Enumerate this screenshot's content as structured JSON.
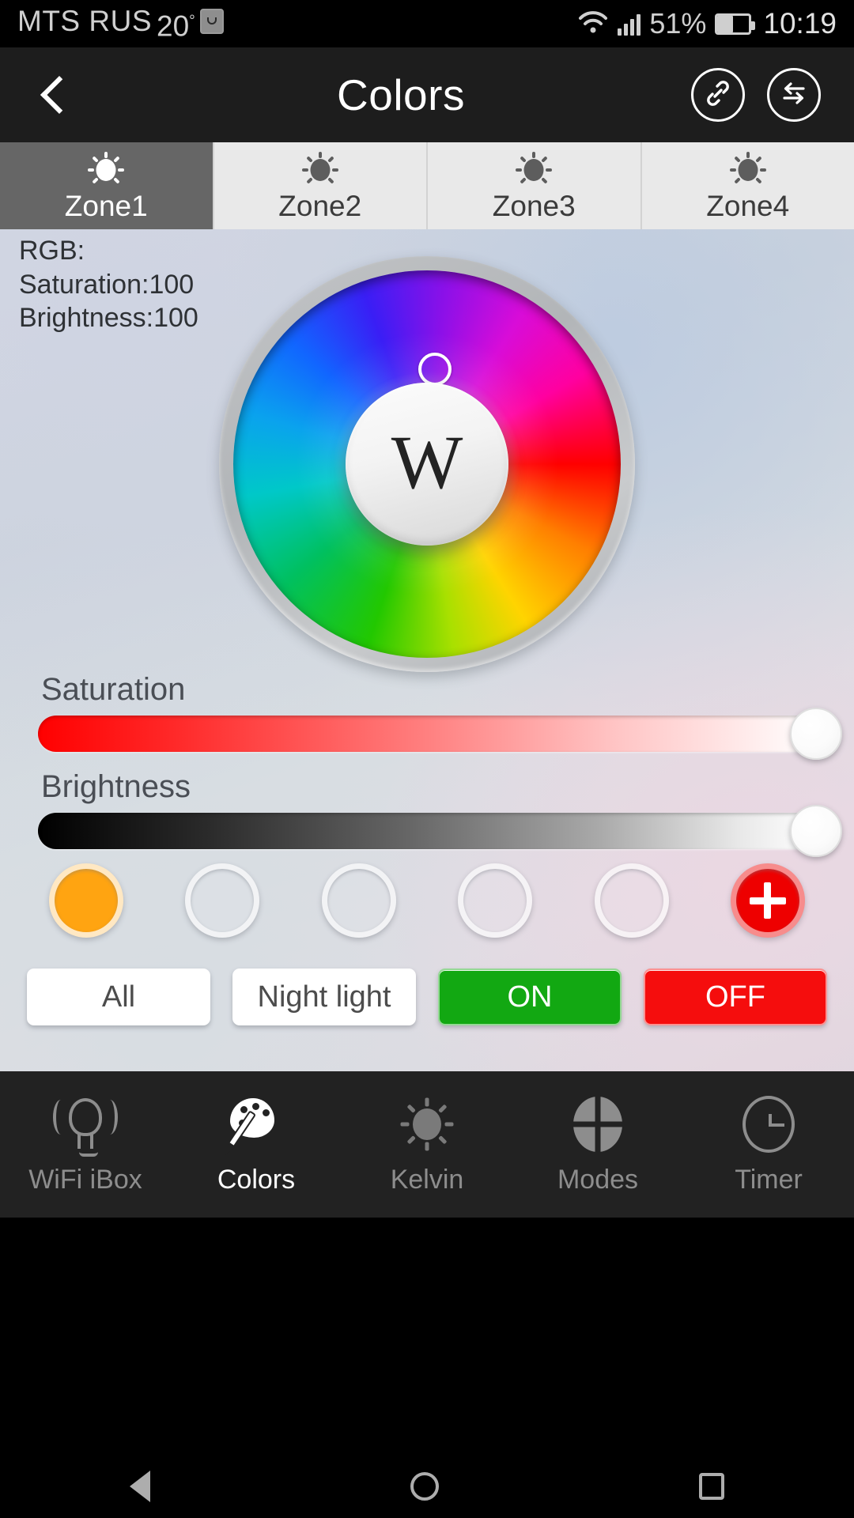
{
  "status_bar": {
    "carrier": "MTS RUS",
    "temperature": "20",
    "degree": "°",
    "battery_percent": "51%",
    "time": "10:19",
    "wifi_icon": "wifi-icon",
    "signal_icon": "cellular-signal-icon",
    "battery_icon": "battery-icon",
    "sim_icon": "sim-indicator-icon"
  },
  "header": {
    "title": "Colors",
    "back_icon": "back-chevron-icon",
    "link_icon": "link-icon",
    "sync_icon": "sync-arrows-icon"
  },
  "zone_tabs": [
    {
      "label": "Zone1",
      "icon": "sun-icon",
      "active": true
    },
    {
      "label": "Zone2",
      "icon": "sun-icon",
      "active": false
    },
    {
      "label": "Zone3",
      "icon": "sun-icon",
      "active": false
    },
    {
      "label": "Zone4",
      "icon": "sun-icon",
      "active": false
    }
  ],
  "info": {
    "rgb": "RGB:",
    "saturation": "Saturation:100",
    "brightness": "Brightness:100"
  },
  "color_wheel": {
    "center_button_label": "W",
    "center_button_name": "white-light-button",
    "selector_name": "color-selector-handle"
  },
  "sliders": {
    "saturation": {
      "label": "Saturation",
      "value": 100,
      "min": 0,
      "max": 100
    },
    "brightness": {
      "label": "Brightness",
      "value": 100,
      "min": 0,
      "max": 100
    }
  },
  "presets": [
    {
      "name": "preset-1",
      "color": "#FFA411",
      "filled": true
    },
    {
      "name": "preset-2",
      "color": "",
      "filled": false
    },
    {
      "name": "preset-3",
      "color": "",
      "filled": false
    },
    {
      "name": "preset-4",
      "color": "",
      "filled": false
    },
    {
      "name": "preset-5",
      "color": "",
      "filled": false
    },
    {
      "name": "add-preset",
      "color": "#EE0000",
      "filled": true,
      "icon": "plus-icon"
    }
  ],
  "action_buttons": [
    {
      "label": "All",
      "style": "white"
    },
    {
      "label": "Night light",
      "style": "white"
    },
    {
      "label": "ON",
      "style": "green"
    },
    {
      "label": "OFF",
      "style": "red"
    }
  ],
  "bottom_nav": [
    {
      "label": "WiFi iBox",
      "icon": "wifi-bulb-icon",
      "active": false
    },
    {
      "label": "Colors",
      "icon": "palette-icon",
      "active": true
    },
    {
      "label": "Kelvin",
      "icon": "sun-icon",
      "active": false
    },
    {
      "label": "Modes",
      "icon": "modes-quadrant-icon",
      "active": false
    },
    {
      "label": "Timer",
      "icon": "clock-icon",
      "active": false
    }
  ],
  "android_nav": {
    "back": "android-back-icon",
    "home": "android-home-icon",
    "recents": "android-recents-icon"
  },
  "colors": {
    "accent_orange": "#FFA411",
    "on_green": "#12A812",
    "off_red": "#F50D0D",
    "add_red": "#EE0000",
    "header_bg": "#1D1D1D",
    "active_tab_bg": "#666666",
    "inactive_tab_bg": "#E9E9E9"
  }
}
